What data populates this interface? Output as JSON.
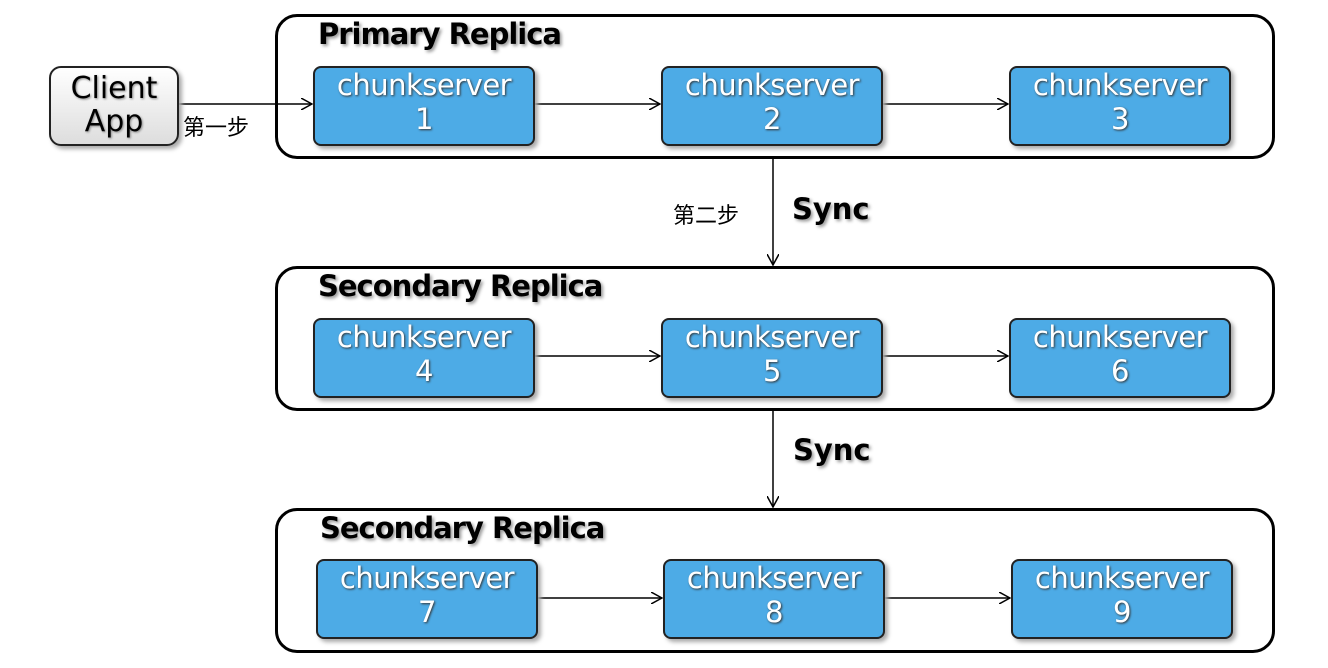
{
  "client": {
    "line1": "Client",
    "line2": "App"
  },
  "step1_label": "第一步",
  "step2_label": "第二步",
  "sync_labels": [
    "Sync",
    "Sync"
  ],
  "groups": [
    {
      "title": "Primary Replica",
      "nodes": [
        {
          "name": "chunkserver",
          "id": "1"
        },
        {
          "name": "chunkserver",
          "id": "2"
        },
        {
          "name": "chunkserver",
          "id": "3"
        }
      ]
    },
    {
      "title": "Secondary Replica",
      "nodes": [
        {
          "name": "chunkserver",
          "id": "4"
        },
        {
          "name": "chunkserver",
          "id": "5"
        },
        {
          "name": "chunkserver",
          "id": "6"
        }
      ]
    },
    {
      "title": "Secondary Replica",
      "nodes": [
        {
          "name": "chunkserver",
          "id": "7"
        },
        {
          "name": "chunkserver",
          "id": "8"
        },
        {
          "name": "chunkserver",
          "id": "9"
        }
      ]
    }
  ],
  "colors": {
    "node_fill": "#4dabe6",
    "border": "#000000"
  }
}
